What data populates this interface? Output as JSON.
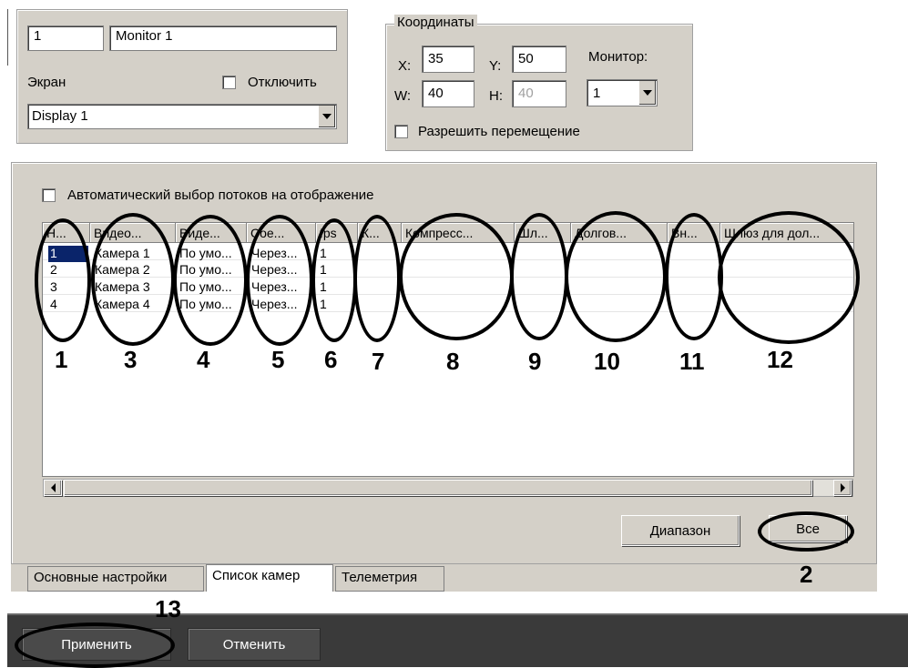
{
  "monitor": {
    "id_value": "1",
    "name_value": "Monitor 1",
    "screen_label": "Экран",
    "disable_label": "Отключить",
    "display_value": "Display 1"
  },
  "coords": {
    "legend": "Координаты",
    "x_label": "X:",
    "x_value": "35",
    "y_label": "Y:",
    "y_value": "50",
    "w_label": "W:",
    "w_value": "40",
    "h_label": "H:",
    "h_value": "40",
    "monitor_label": "Монитор:",
    "monitor_value": "1",
    "allow_move_label": "Разрешить перемещение"
  },
  "cameras": {
    "auto_select_label": "Автоматический выбор потоков на отображение",
    "columns": [
      "Н...",
      "Видео...",
      "Виде...",
      "Сое...",
      "fps",
      "К...",
      "Компресс...",
      "Шл...",
      "Долгов...",
      "Вн...",
      "Шлюз для дол..."
    ],
    "rows": [
      [
        "1",
        "Камера 1",
        "По умо...",
        "Через...",
        "1"
      ],
      [
        "2",
        "Камера 2",
        "По умо...",
        "Через...",
        "1"
      ],
      [
        "3",
        "Камера 3",
        "По умо...",
        "Через...",
        "1"
      ],
      [
        "4",
        "Камера 4",
        "По умо...",
        "Через...",
        "1"
      ]
    ],
    "range_button": "Диапазон",
    "all_button": "Все"
  },
  "callouts": [
    "1",
    "3",
    "4",
    "5",
    "6",
    "7",
    "8",
    "9",
    "10",
    "11",
    "12",
    "2",
    "13"
  ],
  "tabs": [
    "Основные настройки",
    "Список камер",
    "Телеметрия"
  ],
  "footer": {
    "apply_button": "Применить",
    "cancel_button": "Отменить"
  }
}
